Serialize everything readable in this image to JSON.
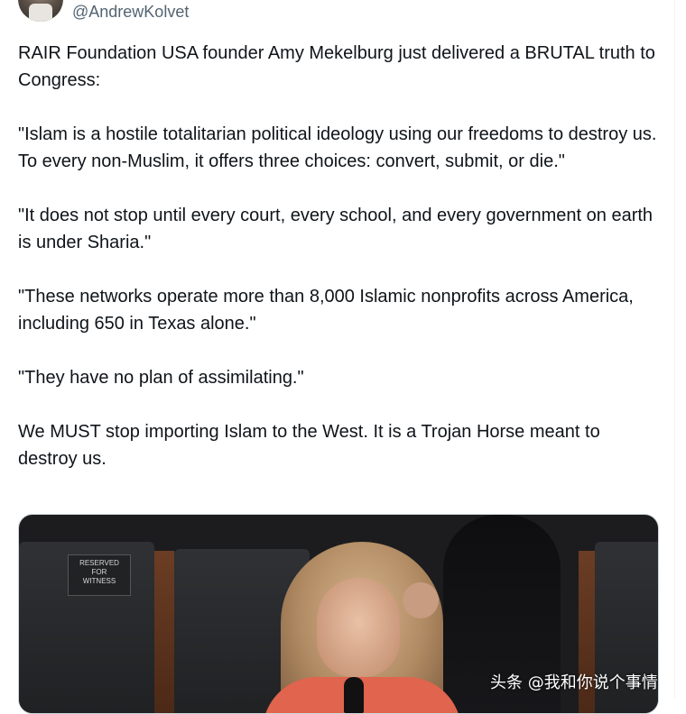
{
  "tweet": {
    "handle": "@AndrewKolvet",
    "paragraphs": [
      "RAIR Foundation USA founder Amy Mekelburg just delivered a BRUTAL truth to Congress:",
      "\"Islam is a hostile totalitarian political ideology using our freedoms to destroy us. To every non-Muslim, it offers three choices: convert, submit, or die.\"",
      "\"It does not stop until every court, every school, and every government on earth is under Sharia.\"",
      "\"These networks operate more than 8,000 Islamic nonprofits across America, including 650 in Texas alone.\"",
      "\"They have no plan of assimilating.\"",
      "We MUST stop importing Islam to the West. It is a Trojan Horse meant to destroy us."
    ]
  },
  "media": {
    "sign_text": [
      "RESERVED",
      "FOR",
      "WITNESS"
    ],
    "watermark": "头条 @我和你说个事情"
  }
}
